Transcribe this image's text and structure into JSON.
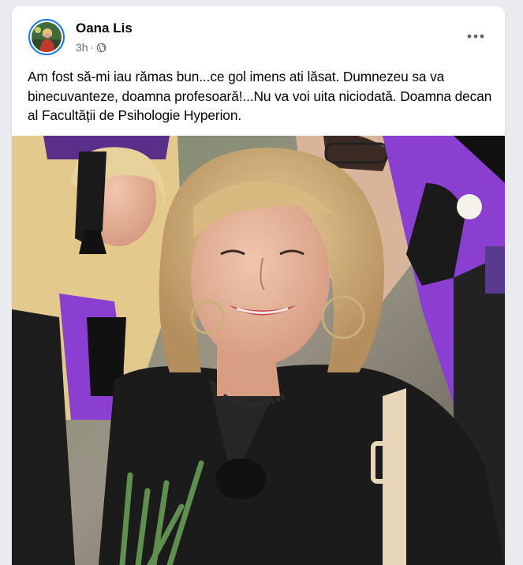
{
  "post": {
    "author": "Oana Lis",
    "time": "3h",
    "audience_icon": "globe-icon",
    "more_icon": "more-options-icon",
    "text": "Am fost să-mi iau rămas bun...ce gol imens ati lăsat. Dumnezeu sa va binecuvanteze, doamna profesoară!...Nu va voi uita niciodată. Doamna decan al Facultății de Psihologie Hyperion.",
    "photo_description_icon": "graduation-photo"
  },
  "colors": {
    "accent": "#1877f2",
    "secondary_text": "#65676b",
    "gown_purple": "#8a3fd1"
  }
}
